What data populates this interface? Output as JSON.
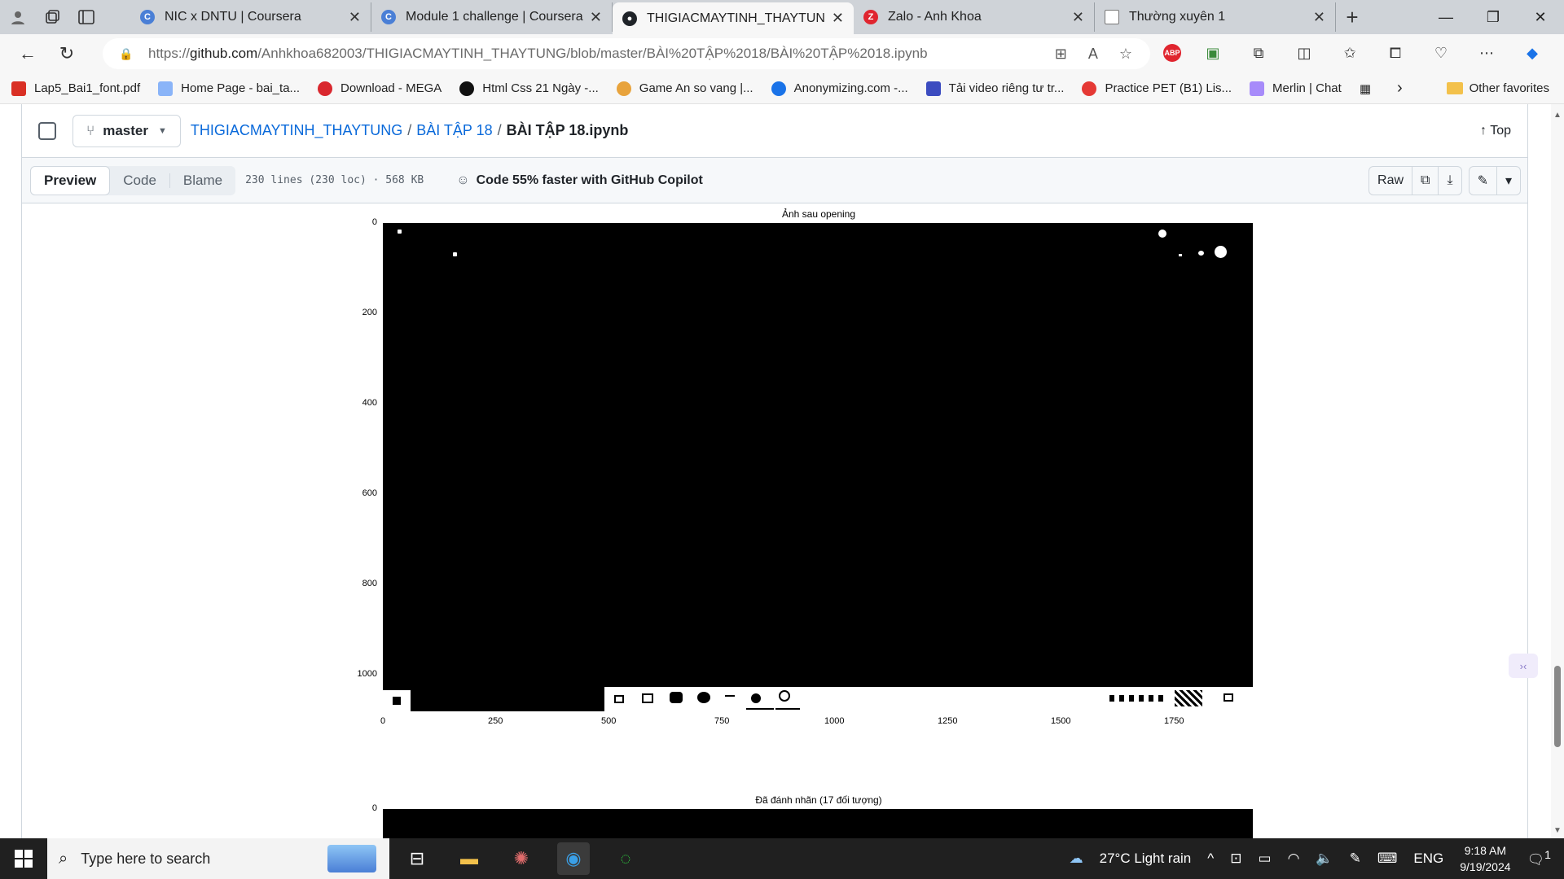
{
  "browser": {
    "tabs": [
      {
        "title": "NIC x DNTU | Coursera",
        "icon": "coursera-icon",
        "color": "#4a7fd6"
      },
      {
        "title": "Module 1 challenge | Coursera",
        "icon": "coursera-icon",
        "color": "#4a7fd6"
      },
      {
        "title": "THIGIACMAYTINH_THAYTUNG/B",
        "icon": "github-icon",
        "color": "#1f2328"
      },
      {
        "title": "Zalo - Anh Khoa",
        "icon": "zalo-icon",
        "color": "#e0252f"
      },
      {
        "title": "Thường xuyên 1",
        "icon": "document-icon",
        "color": "#777"
      }
    ],
    "url_prefix": "https://",
    "url_host": "github.com",
    "url_path": "/Anhkhoa682003/THIGIACMAYTINH_THAYTUNG/blob/master/BÀI%20TẬP%2018/BÀI%20TẬP%2018.ipynb",
    "bookmarks": [
      {
        "label": "Lap5_Bai1_font.pdf",
        "color": "#d93025"
      },
      {
        "label": "Home Page - bai_ta...",
        "color": "#8ab4f8"
      },
      {
        "label": "Download - MEGA",
        "color": "#d9272e"
      },
      {
        "label": "Html Css 21 Ngày -...",
        "color": "#111"
      },
      {
        "label": "Game An so vang |...",
        "color": "#e8a33c"
      },
      {
        "label": "Anonymizing.com -...",
        "color": "#1a73e8"
      },
      {
        "label": "Tải video riêng tư tr...",
        "color": "#3c4cc0"
      },
      {
        "label": "Practice PET (B1) Lis...",
        "color": "#e53935"
      },
      {
        "label": "Merlin | Chat",
        "color": "#a78bfa"
      }
    ],
    "other_favorites": "Other favorites",
    "abp_label": "ABP"
  },
  "repo": {
    "branch": "master",
    "repo_name": "THIGIACMAYTINH_THAYTUNG",
    "folder": "BÀI TẬP 18",
    "file": "BÀI TẬP 18.ipynb",
    "top_label": "Top",
    "tabs": {
      "preview": "Preview",
      "code": "Code",
      "blame": "Blame"
    },
    "meta": "230 lines (230 loc) · 568 KB",
    "copilot": "Code 55% faster with GitHub Copilot",
    "raw": "Raw"
  },
  "figure1": {
    "title": "Ảnh sau opening",
    "yticks": [
      "0",
      "200",
      "400",
      "600",
      "800",
      "1000"
    ],
    "xticks": [
      "0",
      "250",
      "500",
      "750",
      "1000",
      "1250",
      "1500",
      "1750"
    ]
  },
  "figure2": {
    "title": "Đã đánh nhãn (17 đối tượng)",
    "ytick0": "0"
  },
  "taskbar": {
    "search_placeholder": "Type here to search",
    "weather": "27°C  Light rain",
    "lang": "ENG",
    "time": "9:18 AM",
    "date": "9/19/2024",
    "notif": "1"
  }
}
